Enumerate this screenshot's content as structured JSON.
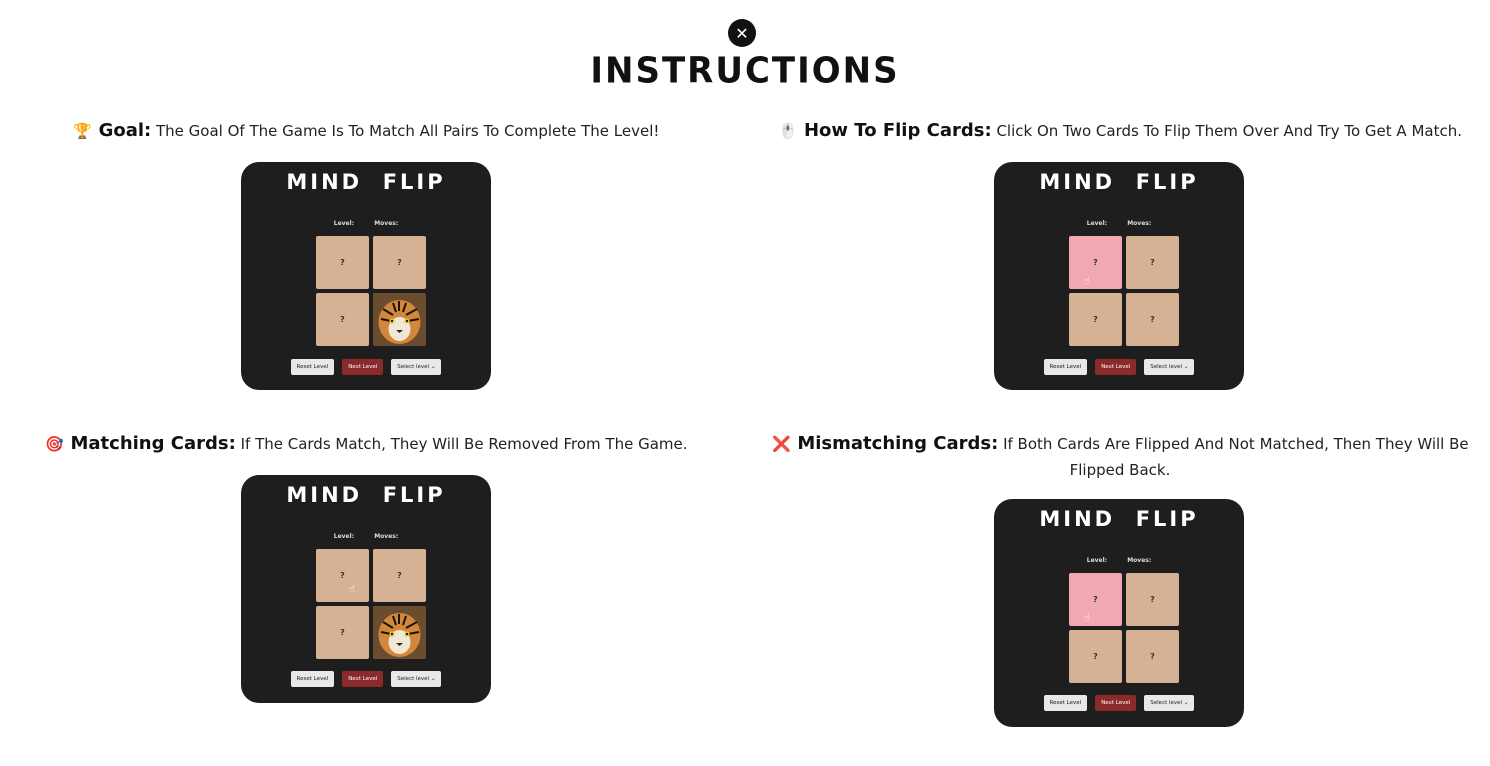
{
  "page": {
    "title": "INSTRUCTIONS",
    "close_icon": "close-icon"
  },
  "sections": [
    {
      "emoji": "🏆",
      "heading": "Goal:",
      "text": "The Goal Of The Game Is To Match All Pairs To Complete The Level!",
      "shot": {
        "title": "MIND  FLIP",
        "level_label": "Level:",
        "moves_label": "Moves:",
        "cards": [
          "?",
          "?",
          "?",
          "tiger"
        ],
        "reset_label": "Reset Level",
        "next_label": "Next Level",
        "select_label": "Select level"
      }
    },
    {
      "emoji": "🖱️",
      "heading": "How To Flip Cards:",
      "text": "Click On Two Cards To Flip Them Over And Try To Get A Match.",
      "shot": {
        "title": "MIND  FLIP",
        "level_label": "Level:",
        "moves_label": "Moves:",
        "cards": [
          "?",
          "?",
          "?",
          "?"
        ],
        "reset_label": "Reset Level",
        "next_label": "Next Level",
        "select_label": "Select level"
      }
    },
    {
      "emoji": "🎯",
      "heading": "Matching Cards:",
      "text": "If The Cards Match, They Will Be Removed From The Game.",
      "shot": {
        "title": "MIND  FLIP",
        "level_label": "Level:",
        "moves_label": "Moves:",
        "cards": [
          "?",
          "?",
          "?",
          "tiger"
        ],
        "reset_label": "Reset Level",
        "next_label": "Next Level",
        "select_label": "Select level"
      }
    },
    {
      "emoji": "❌",
      "heading": "Mismatching Cards:",
      "text": "If Both Cards Are Flipped And Not Matched, Then They Will Be Flipped Back.",
      "shot": {
        "title": "MIND  FLIP",
        "level_label": "Level:",
        "moves_label": "Moves:",
        "cards": [
          "?",
          "?",
          "?",
          "?"
        ],
        "reset_label": "Reset Level",
        "next_label": "Next Level",
        "select_label": "Select level"
      }
    }
  ],
  "colors": {
    "panel_bg": "#1e1e1e",
    "card": "#d6b294",
    "card_flipped": "#f1a8b3",
    "next_button": "#8b2a2a"
  }
}
